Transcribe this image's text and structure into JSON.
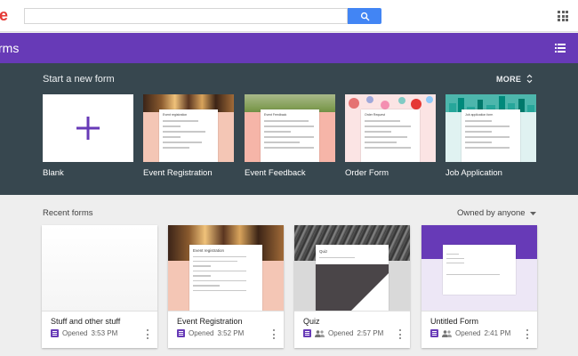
{
  "app": {
    "logo_fragment": "e",
    "header_title": "rms"
  },
  "search": {
    "value": "",
    "placeholder": ""
  },
  "icons": {
    "search": "search-icon",
    "apps": "apps-grid-icon",
    "list_view": "list-view-icon",
    "more_toggle": "unfold-more-icon",
    "dropdown": "arrow-drop-down-icon",
    "form": "forms-icon",
    "shared": "people-icon",
    "menu": "more-vert-icon"
  },
  "colors": {
    "brand": "#673ab7",
    "gallery_bg": "#37474f",
    "search_button": "#4285f4",
    "logo": "#e53935"
  },
  "gallery": {
    "title": "Start a new form",
    "more_label": "MORE",
    "templates": [
      {
        "label": "Blank"
      },
      {
        "label": "Event Registration",
        "sheet_title": "Event registration"
      },
      {
        "label": "Event Feedback",
        "sheet_title": "Event Feedback"
      },
      {
        "label": "Order Form",
        "sheet_title": "Order Request"
      },
      {
        "label": "Job Application",
        "sheet_title": "Job application form"
      }
    ]
  },
  "recent": {
    "title": "Recent forms",
    "owner_filter": "Owned by anyone",
    "forms": [
      {
        "name": "Stuff and other stuff",
        "status": "Opened",
        "time": "3:53 PM",
        "shared": false
      },
      {
        "name": "Event Registration",
        "status": "Opened",
        "time": "3:52 PM",
        "shared": false,
        "sheet_title": "Event registration"
      },
      {
        "name": "Quiz",
        "status": "Opened",
        "time": "2:57 PM",
        "shared": true,
        "sheet_title": "Quiz"
      },
      {
        "name": "Untitled Form",
        "status": "Opened",
        "time": "2:41 PM",
        "shared": true
      }
    ]
  }
}
